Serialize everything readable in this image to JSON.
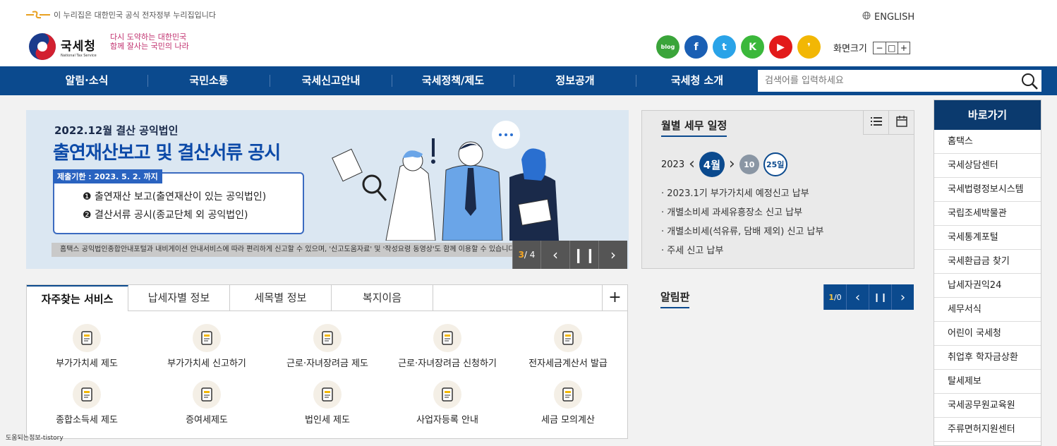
{
  "header": {
    "gov_notice": "이 누리집은 대한민국 공식 전자정부 누리집입니다",
    "english_label": "ENGLISH",
    "agency_name_ko": "국세청",
    "agency_name_en": "National Tax Service",
    "slogan_line1": "다시 도약하는 대한민국",
    "slogan_line2": "함께 잘사는 국민의 나라",
    "font_size_label": "화면크기",
    "font_size_buttons": [
      "−",
      "□",
      "+"
    ],
    "social": [
      {
        "name": "blog",
        "label": "blog",
        "color": "#3aa43a"
      },
      {
        "name": "facebook",
        "label": "f",
        "color": "#1a5fb4"
      },
      {
        "name": "twitter",
        "label": "t",
        "color": "#2aa3e8"
      },
      {
        "name": "kakao-plus",
        "label": "K",
        "color": "#3bb83b"
      },
      {
        "name": "youtube",
        "label": "▶",
        "color": "#e21a1a"
      },
      {
        "name": "kakaostory",
        "label": "❜",
        "color": "#f2b705"
      }
    ]
  },
  "nav": {
    "items": [
      "알림·소식",
      "국민소통",
      "국세신고안내",
      "국세정책/제도",
      "정보공개",
      "국세청 소개"
    ],
    "search_placeholder": "검색어를 입력하세요"
  },
  "banner": {
    "subtitle": "2022.12월 결산 공익법인",
    "title": "출연재산보고 및 결산서류 공시",
    "deadline": "제출기한 : 2023. 5. 2. 까지",
    "line1": "❶ 출연재산 보고(출연재산이 있는 공익법인)",
    "line2": "❷ 결산서류 공시(종교단체 외 공익법인)",
    "caption": "홈택스 공익법인종합안내포털과 내비게이션 안내서비스에 따라 편리하게 신고할 수 있으며, '신고도움자료' 및 '작성요령 동영상'도 함께 이용할 수 있습니다.",
    "current": "3",
    "total": "/ 4"
  },
  "tax_calendar": {
    "title": "월별 세무 일정",
    "year": "2023",
    "month": "4월",
    "day1": "10",
    "day2": "25일",
    "items": [
      "· 2023.1기 부가가치세 예정신고 납부",
      "· 개별소비세 과세유흥장소 신고 납부",
      "· 개별소비세(석유류, 담배 제외) 신고 납부",
      "· 주세 신고 납부"
    ]
  },
  "tabs": {
    "items": [
      "자주찾는 서비스",
      "납세자별 정보",
      "세목별 정보",
      "복지이음"
    ],
    "plus": "+"
  },
  "services": [
    {
      "label": "부가가치세 제도",
      "icon": "book-icon"
    },
    {
      "label": "부가가치세 신고하기",
      "icon": "monitor-icon"
    },
    {
      "label": "근로·자녀장려금 제도",
      "icon": "person-icon"
    },
    {
      "label": "근로·자녀장려금 신청하기",
      "icon": "document-pen-icon"
    },
    {
      "label": "전자세금계산서 발급",
      "icon": "calculator-icon"
    },
    {
      "label": "종합소득세 제도",
      "icon": "lightbulb-person-icon"
    },
    {
      "label": "증여세제도",
      "icon": "exchange-people-icon"
    },
    {
      "label": "법인세 제도",
      "icon": "book-search-icon"
    },
    {
      "label": "사업자등록 안내",
      "icon": "id-card-icon"
    },
    {
      "label": "세금 모의계산",
      "icon": "math-icon"
    }
  ],
  "notice": {
    "title": "알림판",
    "current": "1",
    "total": "/0"
  },
  "quick_links": {
    "title": "바로가기",
    "items": [
      "홈택스",
      "국세상담센터",
      "국세법령정보시스템",
      "국립조세박물관",
      "국세통계포털",
      "국세환급금 찾기",
      "납세자권익24",
      "세무서식",
      "어린이 국세청",
      "취업후 학자금상환",
      "탈세제보",
      "국세공무원교육원",
      "주류면허지원센터"
    ]
  },
  "watermark": "도움되는정보-tistory"
}
